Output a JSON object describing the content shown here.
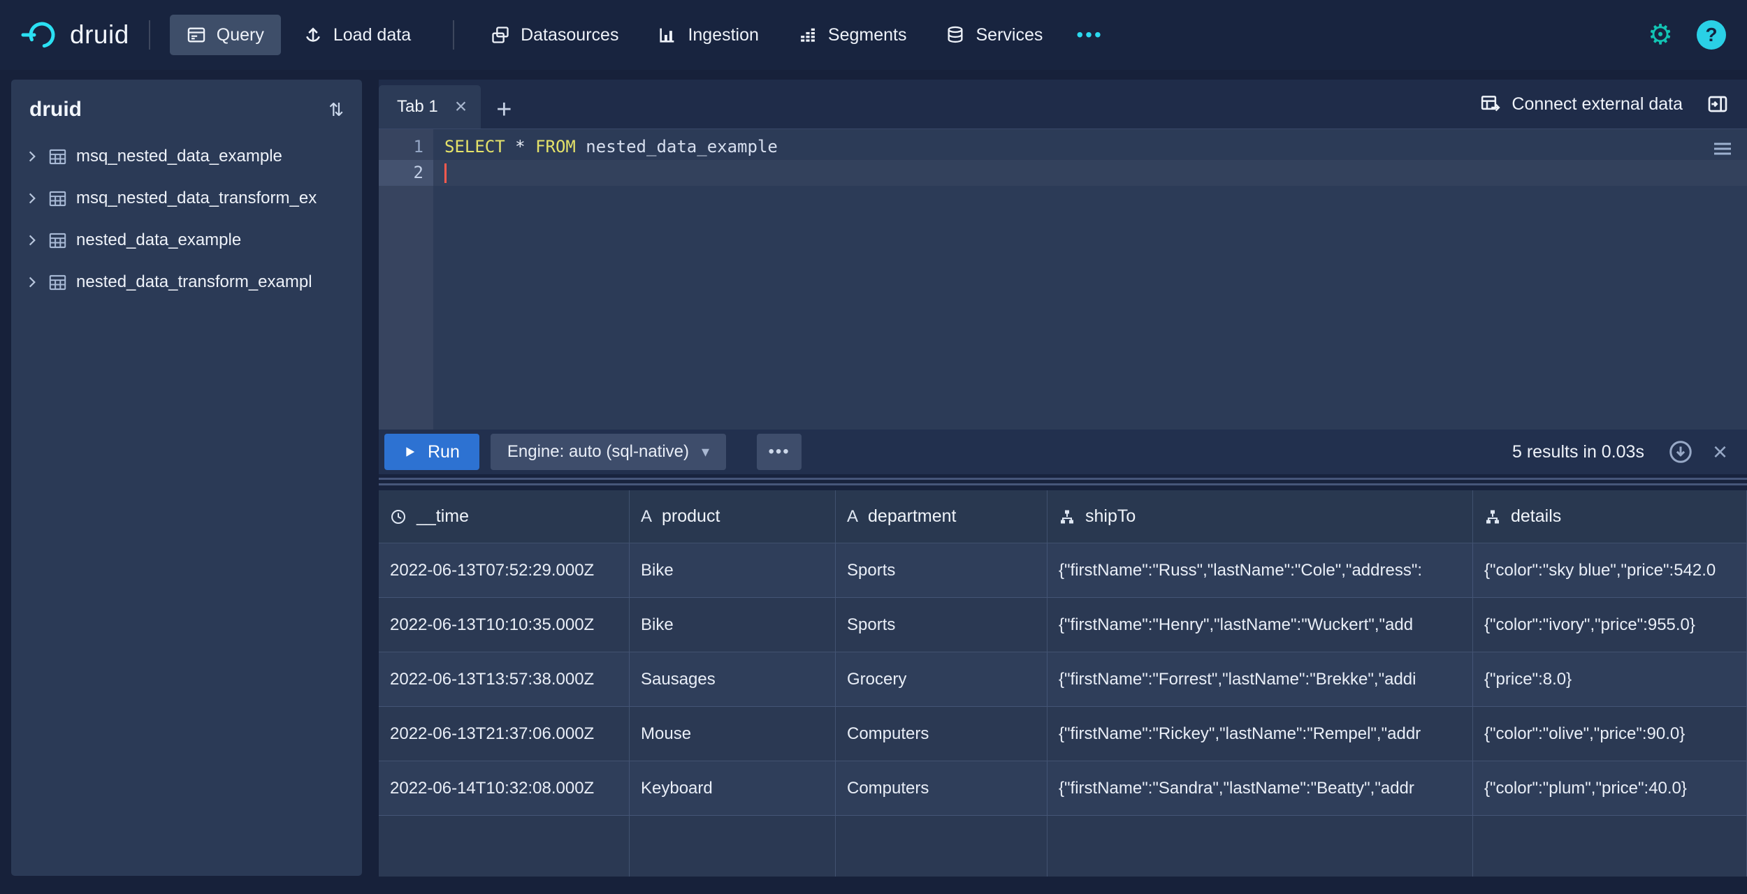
{
  "topbar": {
    "brand": "druid",
    "nav": [
      {
        "label": "Query",
        "active": true
      },
      {
        "label": "Load data",
        "active": false
      },
      {
        "label": "Datasources",
        "active": false
      },
      {
        "label": "Ingestion",
        "active": false
      },
      {
        "label": "Segments",
        "active": false
      },
      {
        "label": "Services",
        "active": false
      }
    ],
    "more": "•••"
  },
  "icons": {
    "gear": "⚙",
    "help": "?",
    "close": "×",
    "plus": "+",
    "more": "•••",
    "caret_down": "▾",
    "sort": "⇅",
    "string": "A"
  },
  "sidebar": {
    "title": "druid",
    "items": [
      {
        "label": "msq_nested_data_example"
      },
      {
        "label": "msq_nested_data_transform_ex"
      },
      {
        "label": "nested_data_example"
      },
      {
        "label": "nested_data_transform_exampl"
      }
    ]
  },
  "main": {
    "tabbar": {
      "tab": "Tab 1",
      "connect": "Connect external data"
    },
    "editor": {
      "lines": [
        "1",
        "2"
      ],
      "sql": {
        "select": "SELECT",
        "star": " * ",
        "from": "FROM",
        "table": " nested_data_example"
      }
    },
    "runbar": {
      "run": "Run",
      "engine": "Engine: auto (sql-native)",
      "results_info": "5 results in 0.03s"
    },
    "results": {
      "columns": [
        {
          "label": "__time",
          "icon": "clock-icon"
        },
        {
          "label": "product",
          "icon": "string-icon"
        },
        {
          "label": "department",
          "icon": "string-icon"
        },
        {
          "label": "shipTo",
          "icon": "nested-data-icon"
        },
        {
          "label": "details",
          "icon": "nested-data-icon"
        }
      ],
      "rows": [
        {
          "time": "2022-06-13T07:52:29.000Z",
          "product": "Bike",
          "department": "Sports",
          "shipTo": "{\"firstName\":\"Russ\",\"lastName\":\"Cole\",\"address\":",
          "details": "{\"color\":\"sky blue\",\"price\":542.0"
        },
        {
          "time": "2022-06-13T10:10:35.000Z",
          "product": "Bike",
          "department": "Sports",
          "shipTo": "{\"firstName\":\"Henry\",\"lastName\":\"Wuckert\",\"add",
          "details": "{\"color\":\"ivory\",\"price\":955.0}"
        },
        {
          "time": "2022-06-13T13:57:38.000Z",
          "product": "Sausages",
          "department": "Grocery",
          "shipTo": "{\"firstName\":\"Forrest\",\"lastName\":\"Brekke\",\"addi",
          "details": "{\"price\":8.0}"
        },
        {
          "time": "2022-06-13T21:37:06.000Z",
          "product": "Mouse",
          "department": "Computers",
          "shipTo": "{\"firstName\":\"Rickey\",\"lastName\":\"Rempel\",\"addr",
          "details": "{\"color\":\"olive\",\"price\":90.0}"
        },
        {
          "time": "2022-06-14T10:32:08.000Z",
          "product": "Keyboard",
          "department": "Computers",
          "shipTo": "{\"firstName\":\"Sandra\",\"lastName\":\"Beatty\",\"addr",
          "details": "{\"color\":\"plum\",\"price\":40.0}"
        }
      ]
    }
  },
  "colors": {
    "accent_cyan": "#2bd9ee",
    "gear_teal": "#12c4b4",
    "run_button_blue": "#2d72d2",
    "keyword_yellow": "#e4e269",
    "cursor_red": "#ff5a4e",
    "panel_bg": "#2b3a56",
    "topbar_bg": "#18243f"
  }
}
